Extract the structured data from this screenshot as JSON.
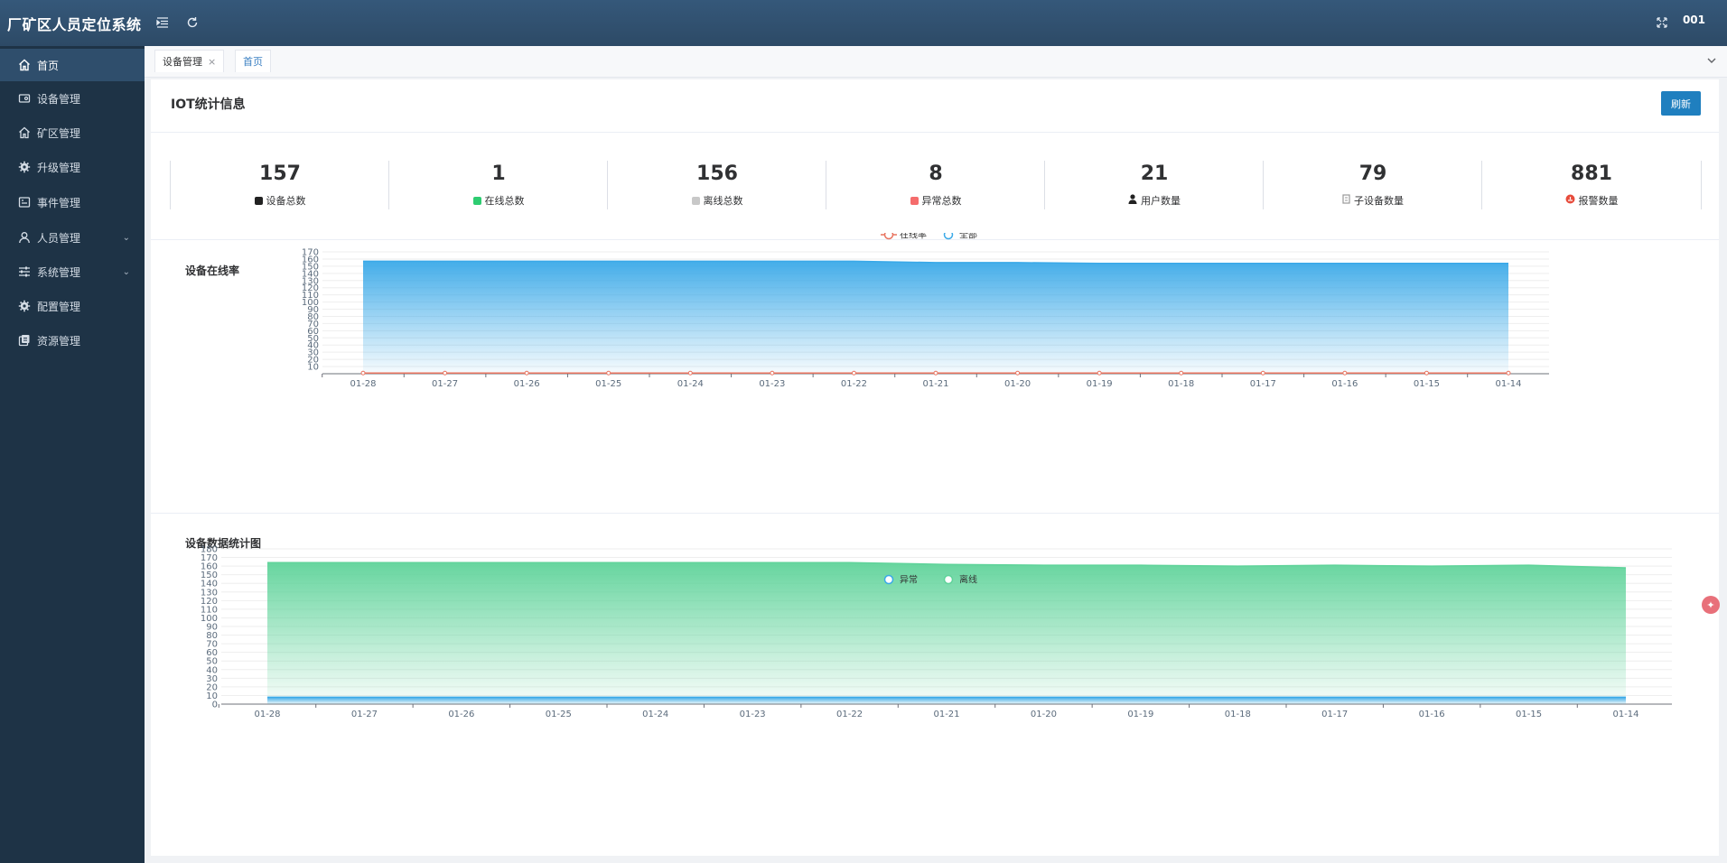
{
  "app": {
    "title": "厂矿区人员定位系统",
    "user": "001"
  },
  "sidebar": {
    "items": [
      {
        "label": "首页",
        "icon": "home-icon",
        "active": true
      },
      {
        "label": "设备管理",
        "icon": "device-icon"
      },
      {
        "label": "矿区管理",
        "icon": "home-icon"
      },
      {
        "label": "升级管理",
        "icon": "gear-icon"
      },
      {
        "label": "事件管理",
        "icon": "event-icon"
      },
      {
        "label": "人员管理",
        "icon": "user-icon",
        "has_children": true
      },
      {
        "label": "系统管理",
        "icon": "sliders-icon",
        "has_children": true
      },
      {
        "label": "配置管理",
        "icon": "gear-icon"
      },
      {
        "label": "资源管理",
        "icon": "resource-icon"
      }
    ]
  },
  "tabs": [
    {
      "label": "设备管理",
      "closable": true
    },
    {
      "label": "首页",
      "closable": false
    }
  ],
  "panel": {
    "title": "IOT统计信息",
    "refresh_label": "刷新"
  },
  "stats": [
    {
      "value": "157",
      "label": "设备总数",
      "color": "#222222"
    },
    {
      "value": "1",
      "label": "在线总数",
      "color": "#2ecc71"
    },
    {
      "value": "156",
      "label": "离线总数",
      "color": "#b8b8b8"
    },
    {
      "value": "8",
      "label": "异常总数",
      "color": "#f56c6c"
    },
    {
      "value": "21",
      "label": "用户数量",
      "color": "#222222"
    },
    {
      "value": "79",
      "label": "子设备数量",
      "color": "#999999"
    },
    {
      "value": "881",
      "label": "报警数量",
      "color": "#e74c3c"
    }
  ],
  "chart_data": [
    {
      "type": "area",
      "title": "设备在线率",
      "categories": [
        "01-28",
        "01-27",
        "01-26",
        "01-25",
        "01-24",
        "01-23",
        "01-22",
        "01-21",
        "01-20",
        "01-19",
        "01-18",
        "01-17",
        "01-16",
        "01-15",
        "01-14"
      ],
      "ylim": [
        0,
        170
      ],
      "yticks": [
        10,
        20,
        30,
        40,
        50,
        60,
        70,
        80,
        90,
        100,
        110,
        120,
        130,
        140,
        150,
        160,
        170
      ],
      "legend_position": "top-center",
      "series": [
        {
          "name": "在线率",
          "type": "line",
          "color": "#e8735f",
          "values": [
            1,
            1,
            1,
            1,
            1,
            1,
            1,
            1,
            1,
            1,
            1,
            1,
            1,
            1,
            1
          ]
        },
        {
          "name": "全部",
          "type": "area",
          "color": "#3aa9e8",
          "values": [
            157,
            157,
            157,
            157,
            157,
            157,
            157,
            155,
            155,
            154,
            154,
            154,
            154,
            154,
            154
          ]
        }
      ]
    },
    {
      "type": "area",
      "title": "设备数据统计图",
      "categories": [
        "01-28",
        "01-27",
        "01-26",
        "01-25",
        "01-24",
        "01-23",
        "01-22",
        "01-21",
        "01-20",
        "01-19",
        "01-18",
        "01-17",
        "01-16",
        "01-15",
        "01-14"
      ],
      "ylim": [
        0,
        180
      ],
      "yticks": [
        0,
        10,
        20,
        30,
        40,
        50,
        60,
        70,
        80,
        90,
        100,
        110,
        120,
        130,
        140,
        150,
        160,
        170,
        180
      ],
      "legend_position": "top-center",
      "series": [
        {
          "name": "异常",
          "type": "area",
          "color": "#3aa9e8",
          "values": [
            8,
            8,
            8,
            8,
            8,
            8,
            8,
            8,
            8,
            8,
            8,
            8,
            8,
            8,
            8
          ]
        },
        {
          "name": "离线",
          "type": "area",
          "color": "#5fd39a",
          "values": [
            164,
            164,
            164,
            164,
            164,
            164,
            164,
            162,
            161,
            161,
            160,
            161,
            160,
            161,
            158
          ]
        }
      ]
    }
  ]
}
